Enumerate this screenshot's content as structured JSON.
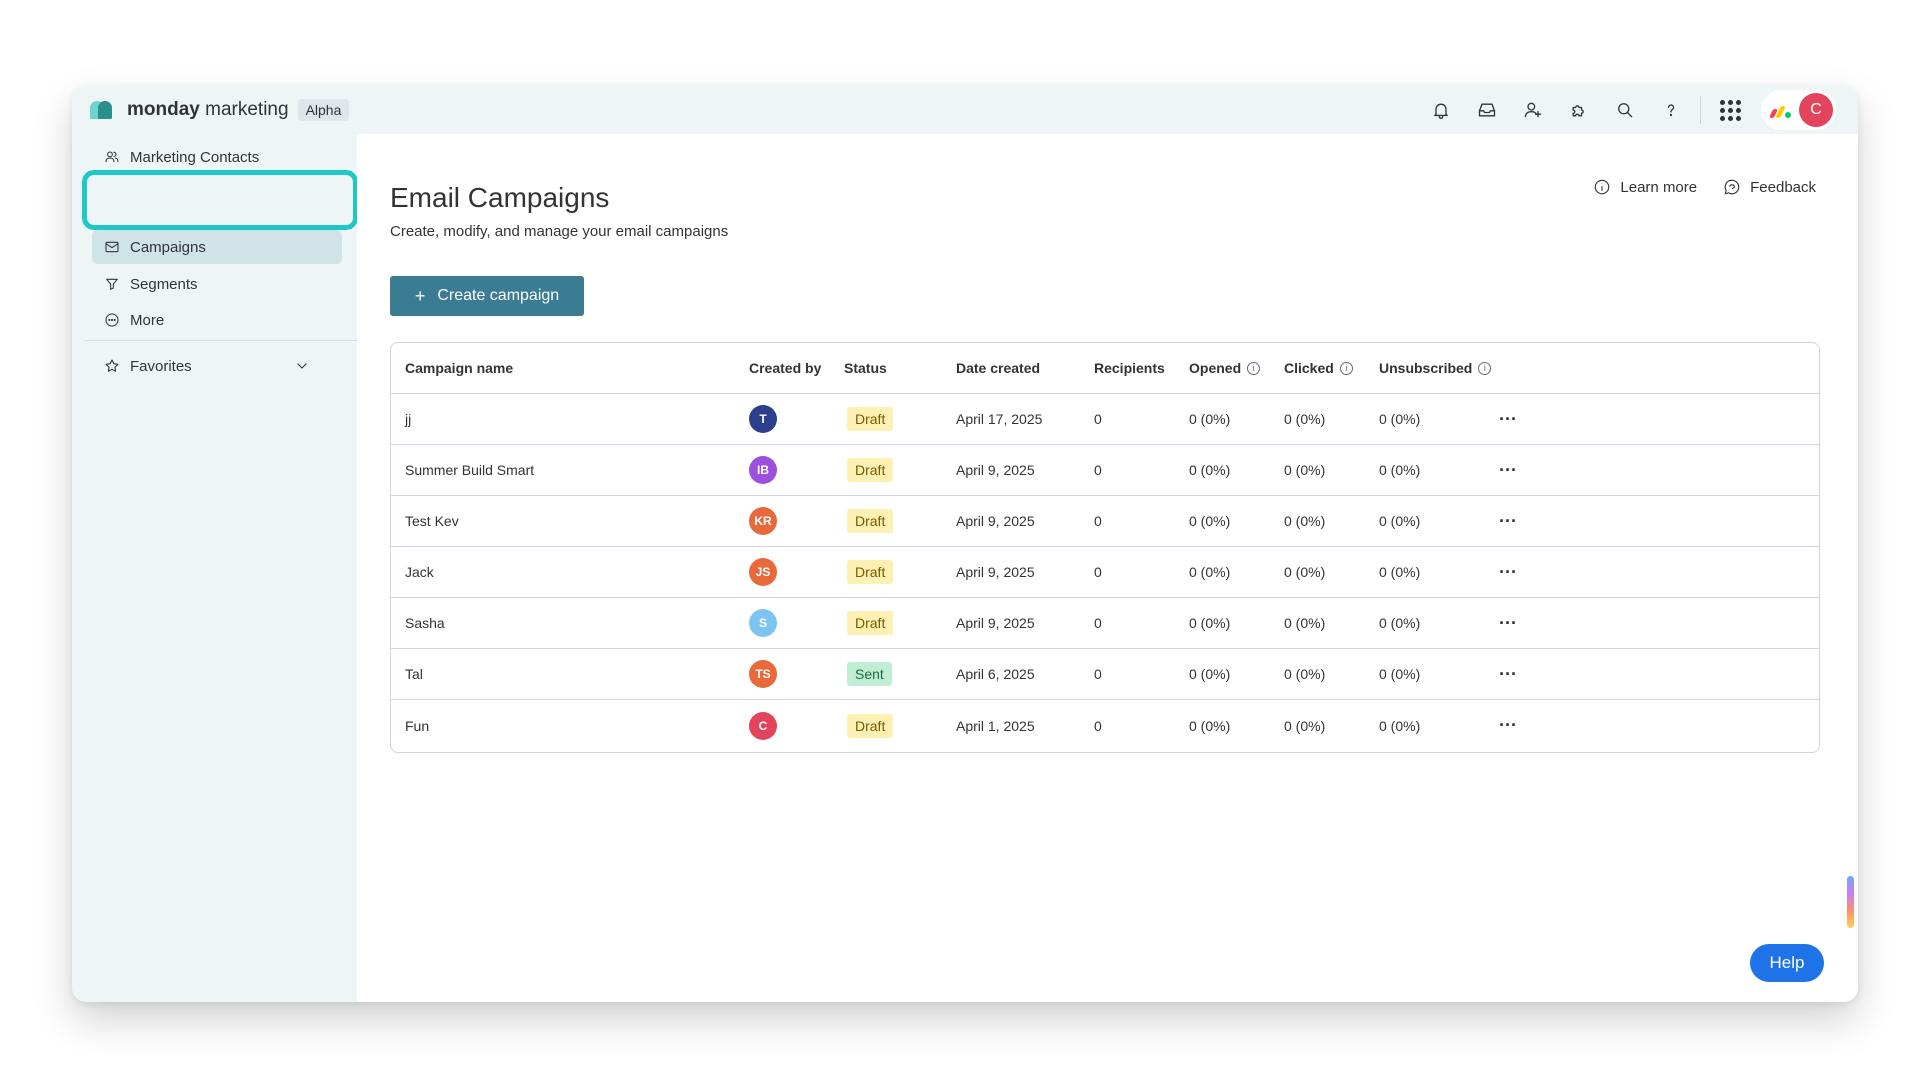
{
  "brand": {
    "name_bold": "monday",
    "name_rest": " marketing",
    "badge": "Alpha"
  },
  "topbar": {
    "icons": [
      "bell-icon",
      "inbox-icon",
      "invite-user-icon",
      "puzzle-icon",
      "search-icon",
      "help-icon",
      "apps-grid-icon"
    ],
    "user_initial": "C",
    "colors": {
      "avatar": "#e2445c",
      "mon_red": "#f6404f",
      "mon_yellow": "#ffcb00",
      "mon_green": "#00ca72"
    }
  },
  "sidebar": {
    "items": [
      {
        "label": "Marketing Contacts",
        "icon": "contacts-icon"
      },
      {
        "label": "Campaigns",
        "icon": "mail-icon",
        "active": true
      },
      {
        "label": "Segments",
        "icon": "filter-icon"
      },
      {
        "label": "More",
        "icon": "more-circle-icon"
      }
    ],
    "favorites": "Favorites"
  },
  "page": {
    "title": "Email Campaigns",
    "subtitle": "Create, modify, and manage your email campaigns",
    "learn_more": "Learn more",
    "feedback": "Feedback",
    "create_button": "Create campaign"
  },
  "table": {
    "headers": [
      "Campaign name",
      "Created by",
      "Status",
      "Date created",
      "Recipients",
      "Opened",
      "Clicked",
      "Unsubscribed"
    ],
    "rows": [
      {
        "name": "jj",
        "initials": "T",
        "avatar_color": "#2b3f8c",
        "status": "Draft",
        "date": "April 17, 2025",
        "recipients": "0",
        "opened": "0 (0%)",
        "clicked": "0 (0%)",
        "unsubscribed": "0 (0%)"
      },
      {
        "name": "Summer Build Smart",
        "initials": "IB",
        "avatar_color": "#9d50dd",
        "status": "Draft",
        "date": "April 9, 2025",
        "recipients": "0",
        "opened": "0 (0%)",
        "clicked": "0 (0%)",
        "unsubscribed": "0 (0%)"
      },
      {
        "name": "Test Kev",
        "initials": "KR",
        "avatar_color": "#e8693a",
        "status": "Draft",
        "date": "April 9, 2025",
        "recipients": "0",
        "opened": "0 (0%)",
        "clicked": "0 (0%)",
        "unsubscribed": "0 (0%)"
      },
      {
        "name": "Jack",
        "initials": "JS",
        "avatar_color": "#e8693a",
        "status": "Draft",
        "date": "April 9, 2025",
        "recipients": "0",
        "opened": "0 (0%)",
        "clicked": "0 (0%)",
        "unsubscribed": "0 (0%)"
      },
      {
        "name": "Sasha",
        "initials": "S",
        "avatar_color": "#7ec4f2",
        "status": "Draft",
        "date": "April 9, 2025",
        "recipients": "0",
        "opened": "0 (0%)",
        "clicked": "0 (0%)",
        "unsubscribed": "0 (0%)"
      },
      {
        "name": "Tal",
        "initials": "TS",
        "avatar_color": "#e8693a",
        "status": "Sent",
        "date": "April 6, 2025",
        "recipients": "0",
        "opened": "0 (0%)",
        "clicked": "0 (0%)",
        "unsubscribed": "0 (0%)"
      },
      {
        "name": "Fun",
        "initials": "C",
        "avatar_color": "#e2445c",
        "status": "Draft",
        "date": "April 1, 2025",
        "recipients": "0",
        "opened": "0 (0%)",
        "clicked": "0 (0%)",
        "unsubscribed": "0 (0%)"
      }
    ],
    "row_menu": "···"
  },
  "help_button": "Help",
  "colors": {
    "primary_button": "#3b7c92",
    "highlight": "#1ec8c8",
    "help": "#1f73e8"
  }
}
